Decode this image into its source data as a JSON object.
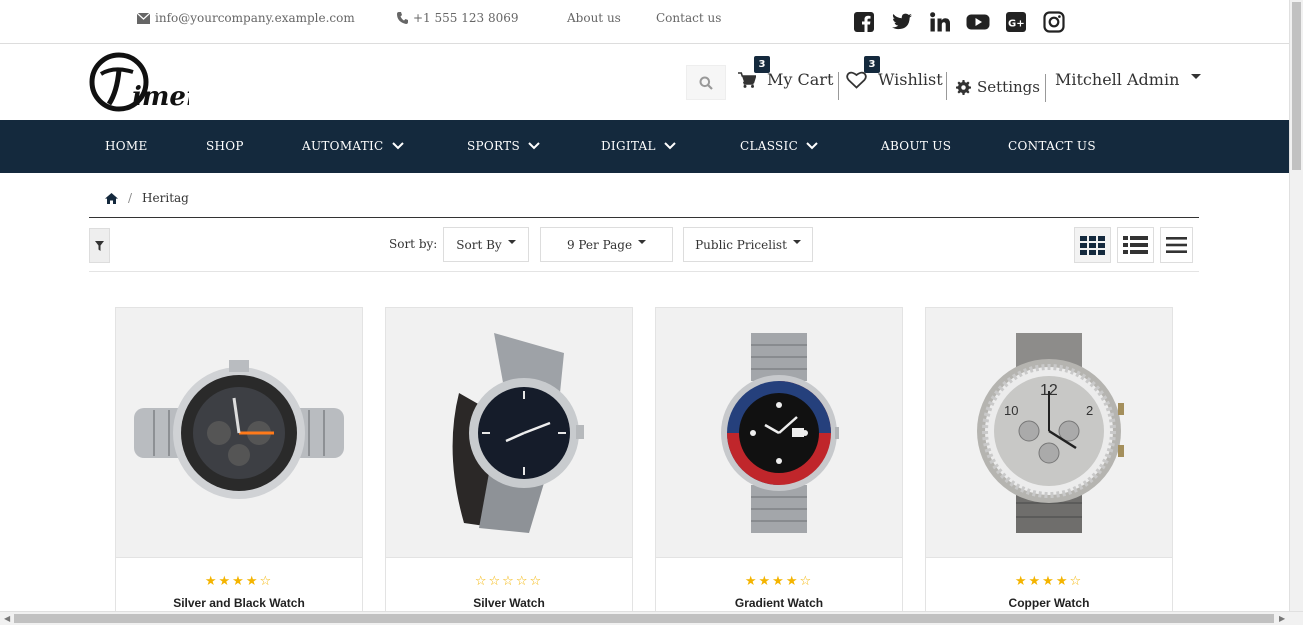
{
  "topbar": {
    "email": "info@yourcompany.example.com",
    "phone": "+1 555 123 8069",
    "about": "About us",
    "contact": "Contact us",
    "social": [
      "facebook-icon",
      "twitter-icon",
      "linkedin-icon",
      "youtube-icon",
      "google-plus-icon",
      "instagram-icon"
    ]
  },
  "header": {
    "logo_text": "imer",
    "cart_label": "My Cart",
    "cart_count": "3",
    "wishlist_label": "Wishlist",
    "wishlist_count": "3",
    "settings_label": "Settings",
    "user_label": "Mitchell Admin"
  },
  "nav": {
    "items": [
      "HOME",
      "SHOP",
      "AUTOMATIC",
      "SPORTS",
      "DIGITAL",
      "CLASSIC",
      "ABOUT US",
      "CONTACT US"
    ]
  },
  "breadcrumb": {
    "current": "Heritag"
  },
  "toolbar": {
    "sort_by_label": "Sort by:",
    "sort_value": "Sort By",
    "per_page": "9 Per Page",
    "pricelist": "Public Pricelist"
  },
  "products": [
    {
      "name": "Silver and Black Watch",
      "stars": "★★★★☆"
    },
    {
      "name": "Silver Watch",
      "stars": "☆☆☆☆☆"
    },
    {
      "name": "Gradient Watch",
      "stars": "★★★★☆"
    },
    {
      "name": "Copper Watch",
      "stars": "★★★★☆"
    }
  ],
  "colors": {
    "nav_bg": "#14293d",
    "star": "#f4b400",
    "accent": "#14293d"
  }
}
